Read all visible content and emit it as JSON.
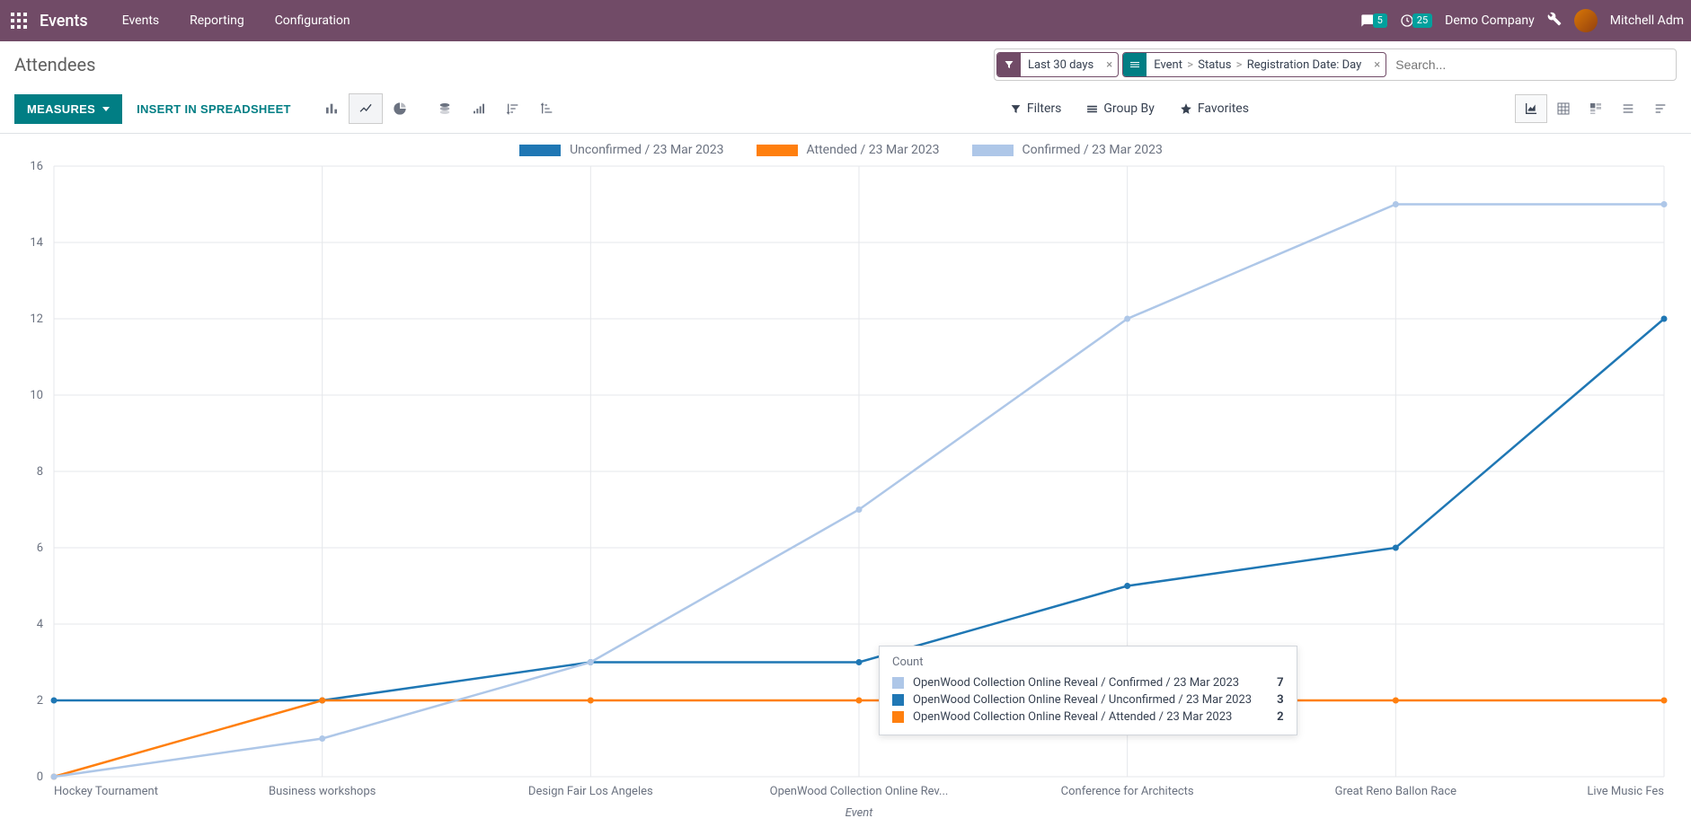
{
  "navbar": {
    "brand": "Events",
    "menu": [
      "Events",
      "Reporting",
      "Configuration"
    ],
    "chat_badge": "5",
    "clock_badge": "25",
    "company": "Demo Company",
    "user": "Mitchell Adm"
  },
  "breadcrumb": {
    "title": "Attendees"
  },
  "search": {
    "placeholder": "Search...",
    "facet_filter": {
      "label": "Last 30 days"
    },
    "facet_group": {
      "parts": [
        "Event",
        "Status",
        "Registration Date: Day"
      ]
    }
  },
  "toolbar": {
    "measures": "MEASURES",
    "spreadsheet": "INSERT IN SPREADSHEET",
    "filters": "Filters",
    "groupby": "Group By",
    "favorites": "Favorites"
  },
  "chart_data": {
    "type": "line",
    "xlabel": "Event",
    "ylabel": "",
    "ylim": [
      0,
      16
    ],
    "yticks": [
      0,
      2,
      4,
      6,
      8,
      10,
      12,
      14,
      16
    ],
    "categories": [
      "Hockey Tournament",
      "Business workshops",
      "Design Fair Los Angeles",
      "OpenWood Collection Online Rev...",
      "Conference for Architects",
      "Great Reno Ballon Race",
      "Live Music Fes"
    ],
    "series": [
      {
        "name": "Unconfirmed / 23 Mar 2023",
        "color": "#1f77b4",
        "values": [
          2,
          2,
          3,
          3,
          5,
          6,
          12
        ]
      },
      {
        "name": "Attended / 23 Mar 2023",
        "color": "#ff7f0e",
        "values": [
          0,
          2,
          2,
          2,
          2,
          2,
          2
        ]
      },
      {
        "name": "Confirmed / 23 Mar 2023",
        "color": "#aec7e8",
        "values": [
          0,
          1,
          3,
          7,
          12,
          15,
          15
        ]
      }
    ]
  },
  "tooltip": {
    "title": "Count",
    "rows": [
      {
        "color": "#aec7e8",
        "label": "OpenWood Collection Online Reveal / Confirmed / 23 Mar 2023",
        "value": "7"
      },
      {
        "color": "#1f77b4",
        "label": "OpenWood Collection Online Reveal / Unconfirmed / 23 Mar 2023",
        "value": "3"
      },
      {
        "color": "#ff7f0e",
        "label": "OpenWood Collection Online Reveal / Attended / 23 Mar 2023",
        "value": "2"
      }
    ]
  },
  "colors": {
    "primary": "#714B67",
    "teal": "#017e84"
  }
}
